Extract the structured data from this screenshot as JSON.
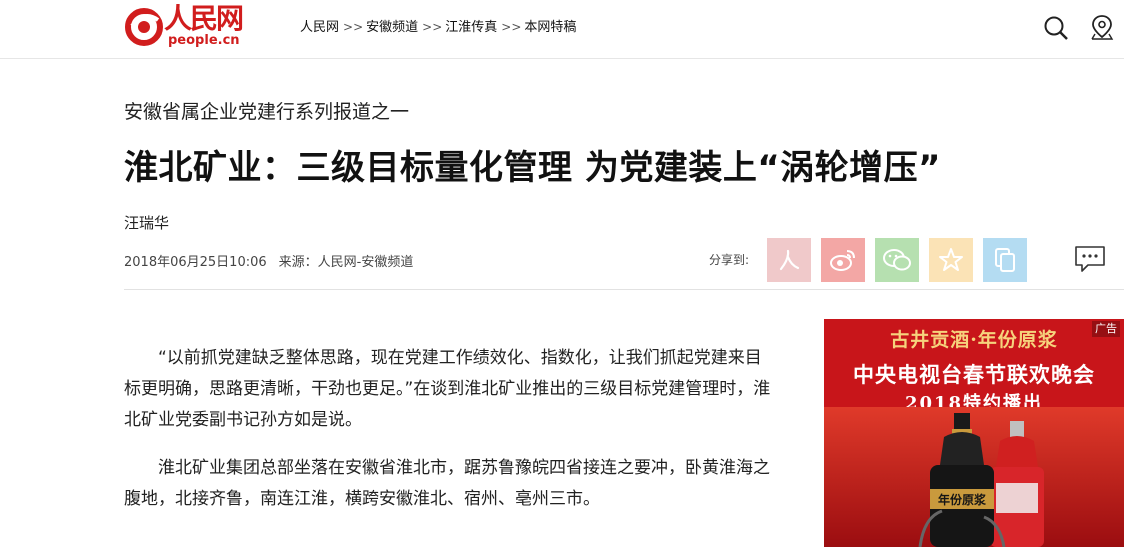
{
  "header": {
    "logo_text": "人民网",
    "logo_url": "people.cn",
    "breadcrumb": [
      "人民网",
      "安徽频道",
      "江淮传真",
      "本网特稿"
    ],
    "breadcrumb_sep": ">>"
  },
  "article": {
    "kicker": "安徽省属企业党建行系列报道之一",
    "title": "淮北矿业：三级目标量化管理 为党建装上“涡轮增压”",
    "author": "汪瑞华",
    "date": "2018年06月25日10:06",
    "source": "来源：人民网-安徽频道",
    "share_label": "分享到:",
    "paragraphs": [
      "“以前抓党建缺乏整体思路，现在党建工作绩效化、指数化，让我们抓起党建来目标更明确，思路更清晰，干劲也更足。”在谈到淮北矿业推出的三级目标党建管理时，淮北矿业党委副书记孙方如是说。",
      "淮北矿业集团总部坐落在安徽省淮北市，踞苏鲁豫皖四省接连之要冲，卧黄淮海之腹地，北接齐鲁，南连江淮，横跨安徽淮北、宿州、亳州三市。"
    ]
  },
  "ad": {
    "tag": "广告",
    "brand": "古井贡酒·年份原浆",
    "line1": "中央电视台春节联欢晚会",
    "line2": "2018特约播出",
    "bottle_label": "年份原浆"
  },
  "colors": {
    "brand_red": "#d11d1d",
    "share_renmin": "#f0c9ca",
    "share_weibo": "#f3a7a5",
    "share_wechat": "#b6e0b0",
    "share_qzone": "#fbe3b6",
    "share_copy": "#b4dcf2",
    "ad_bg": "#c8151a"
  },
  "icons": {
    "search": "search-icon",
    "location": "location-pin-icon",
    "comment": "comment-icon",
    "share": [
      "renmin-icon",
      "weibo-icon",
      "wechat-icon",
      "qzone-star-icon",
      "copy-icon"
    ]
  }
}
